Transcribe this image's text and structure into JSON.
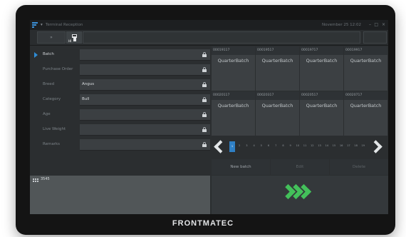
{
  "titlebar": {
    "app_title": "Terminal Reception",
    "date": "November 25 12:02",
    "minimize": "–",
    "maximize": "□",
    "close": "×"
  },
  "toolbar": {
    "btn1_label": "»",
    "btn2_label": "HI"
  },
  "form": {
    "rows": [
      {
        "label": "Batch",
        "value": ""
      },
      {
        "label": "Purchase Order",
        "value": ""
      },
      {
        "label": "Breed",
        "value": "Angus"
      },
      {
        "label": "Category",
        "value": "Bull"
      },
      {
        "label": "Age",
        "value": ""
      },
      {
        "label": "Live Weight",
        "value": ""
      },
      {
        "label": "Remarks",
        "value": ""
      }
    ]
  },
  "batches": [
    {
      "id": "00019117",
      "name": "QuarterBatch"
    },
    {
      "id": "00019517",
      "name": "QuarterBatch"
    },
    {
      "id": "00019717",
      "name": "QuarterBatch"
    },
    {
      "id": "00019917",
      "name": "QuarterBatch"
    },
    {
      "id": "00020117",
      "name": "QuarterBatch"
    },
    {
      "id": "00020317",
      "name": "QuarterBatch"
    },
    {
      "id": "00020517",
      "name": "QuarterBatch"
    },
    {
      "id": "00020717",
      "name": "QuarterBatch"
    }
  ],
  "pager": {
    "pages": [
      "1",
      "2",
      "3",
      "4",
      "5",
      "6",
      "7",
      "8",
      "9",
      "10",
      "11",
      "12",
      "13",
      "14",
      "15",
      "16",
      "17",
      "18",
      "19"
    ],
    "active_page": "1"
  },
  "actions": {
    "new_batch": "New batch",
    "edit": "Edit",
    "delete": "Delete"
  },
  "info": {
    "count": "3545"
  },
  "brand": "FRONTMATEC",
  "colors": {
    "accent": "#2f7fc4",
    "go": "#43c05a"
  }
}
